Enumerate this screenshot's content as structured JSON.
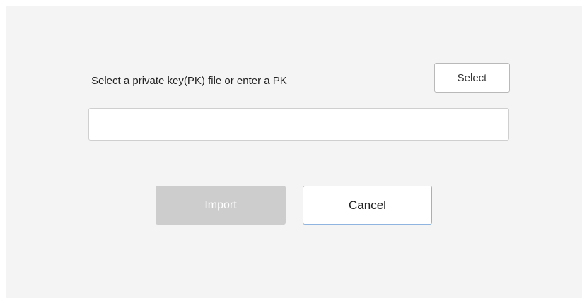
{
  "dialog": {
    "prompt": "Select a private key(PK) file or enter a PK",
    "select_label": "Select",
    "pk_value": "",
    "import_label": "Import",
    "cancel_label": "Cancel"
  },
  "colors": {
    "dialog_background": "#f4f4f4",
    "import_disabled": "#cdcdcd",
    "cancel_border": "#8fb4e0"
  }
}
